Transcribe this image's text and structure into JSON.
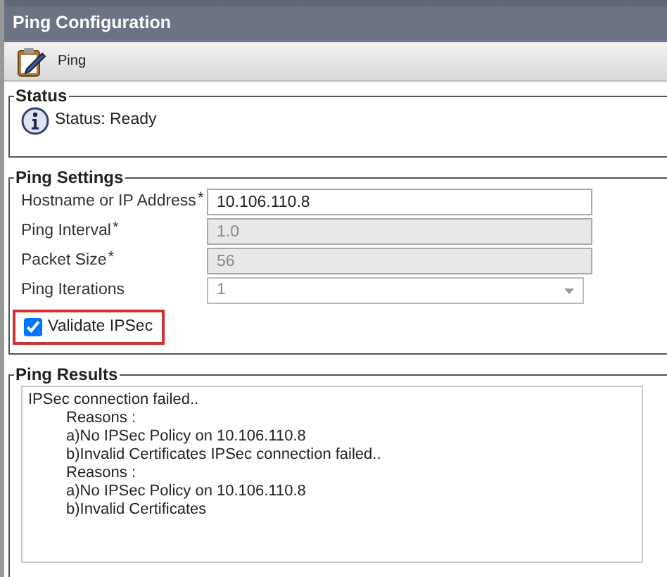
{
  "header": {
    "title": "Ping Configuration"
  },
  "toolbar": {
    "button": "Ping"
  },
  "status": {
    "legend": "Status",
    "text": "Status: Ready"
  },
  "settings": {
    "legend": "Ping Settings",
    "fields": [
      {
        "kind": "text",
        "label": "Hostname or IP Address",
        "required_mark": "*",
        "value": "10.106.110.8",
        "disabled": false
      },
      {
        "kind": "text",
        "label": "Ping Interval",
        "required_mark": "*",
        "value": "1.0",
        "disabled": true
      },
      {
        "kind": "text",
        "label": "Packet Size",
        "required_mark": "*",
        "value": "56",
        "disabled": true
      },
      {
        "kind": "select",
        "label": "Ping Iterations",
        "value": "1",
        "disabled": true
      }
    ],
    "checkbox": {
      "label": "Validate IPSec",
      "checked": true,
      "highlighted": true
    }
  },
  "results": {
    "legend": "Ping Results",
    "lines": [
      {
        "kind": "plain",
        "text": "IPSec connection failed.."
      },
      {
        "kind": "indented",
        "text": "Reasons :"
      },
      {
        "kind": "indented",
        "text": "a)No IPSec Policy on 10.106.110.8"
      },
      {
        "kind": "indented",
        "text": "b)Invalid Certificates IPSec connection failed.."
      },
      {
        "kind": "indented",
        "text": "Reasons :"
      },
      {
        "kind": "indented",
        "text": "a)No IPSec Policy on 10.106.110.8"
      },
      {
        "kind": "indented",
        "text": "b)Invalid Certificates"
      }
    ]
  }
}
